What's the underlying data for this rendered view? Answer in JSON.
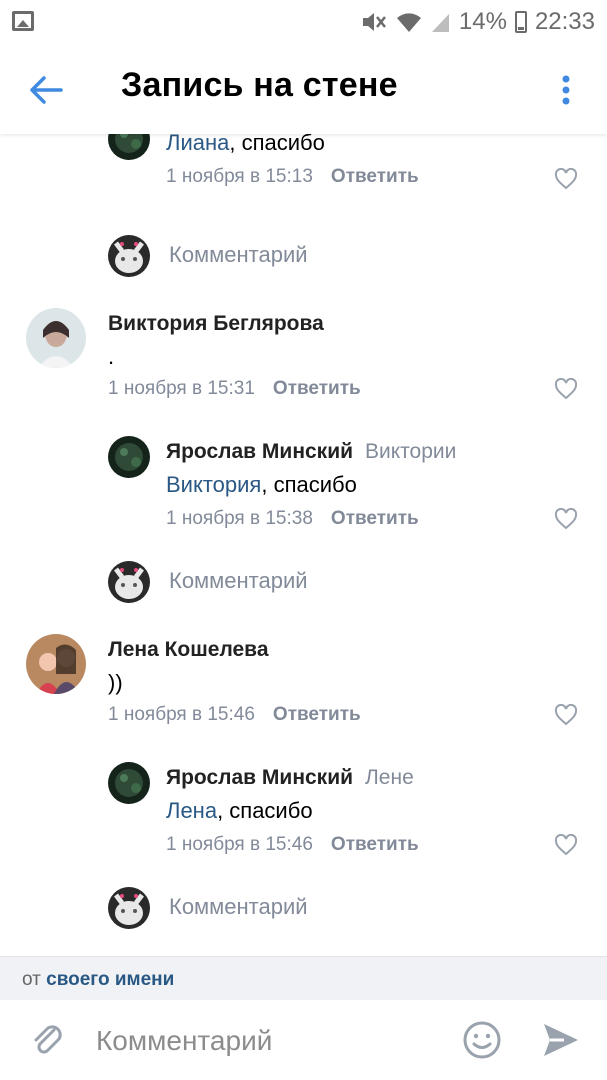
{
  "status_bar": {
    "battery": "14%",
    "time": "22:33"
  },
  "toolbar": {
    "title": "Запись на стене"
  },
  "comments": [
    {
      "text_mention": "Лиана",
      "text_rest": ", спасибо",
      "date": "1 ноября в 15:13",
      "reply_label": "Ответить"
    },
    {
      "author": "Виктория Беглярова",
      "text": ".",
      "date": "1 ноября в 15:31",
      "reply_label": "Ответить"
    },
    {
      "author": "Ярослав Минский",
      "reply_to": "Виктории",
      "text_mention": "Виктория",
      "text_rest": ", спасибо",
      "date": "1 ноября в 15:38",
      "reply_label": "Ответить"
    },
    {
      "author": "Лена Кошелева",
      "text": "))",
      "date": "1 ноября в 15:46",
      "reply_label": "Ответить"
    },
    {
      "author": "Ярослав Минский",
      "reply_to": "Лене",
      "text_mention": "Лена",
      "text_rest": ", спасибо",
      "date": "1 ноября в 15:46",
      "reply_label": "Ответить"
    }
  ],
  "add_comment_label": "Комментарий",
  "from_bar": {
    "prefix": "от",
    "name": "своего имени"
  },
  "input": {
    "placeholder": "Комментарий"
  },
  "colors": {
    "accent": "#2a5885",
    "icon": "#99a2ad",
    "secondary_text": "#828a99"
  }
}
